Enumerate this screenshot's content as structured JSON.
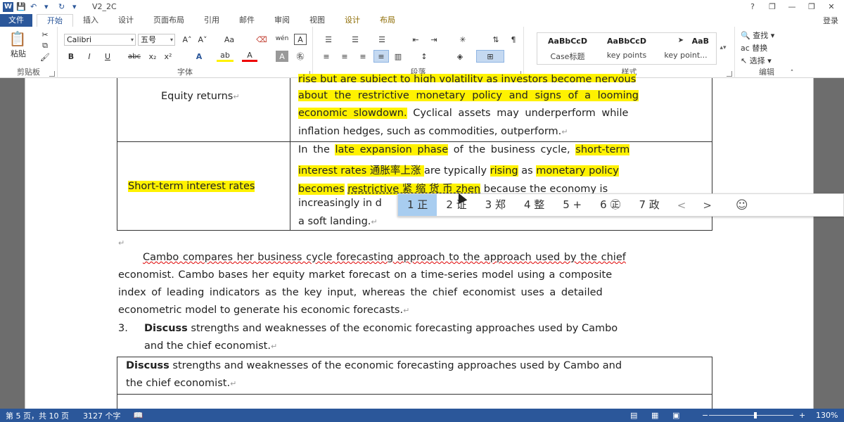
{
  "titlebar": {
    "title": "V2_2C",
    "help": "?",
    "min": "—",
    "restore": "❐",
    "close": "✕",
    "qa_save": "💾",
    "qa_undo": "↶",
    "qa_redo": "↻",
    "qa_dd": "▾",
    "app_icon": "W"
  },
  "tabs": [
    {
      "label": "文件"
    },
    {
      "label": "开始"
    },
    {
      "label": "插入"
    },
    {
      "label": "设计"
    },
    {
      "label": "页面布局"
    },
    {
      "label": "引用"
    },
    {
      "label": "邮件"
    },
    {
      "label": "审阅"
    },
    {
      "label": "视图"
    },
    {
      "label": "设计"
    },
    {
      "label": "布局"
    }
  ],
  "login": "登录",
  "ribbon": {
    "clipboard": {
      "label": "剪贴板",
      "paste": "粘贴"
    },
    "font": {
      "label": "字体",
      "font_name": "Calibri",
      "font_size": "五号",
      "grow": "A˄",
      "shrink": "A˅",
      "case": "Aa",
      "clear": "⌫",
      "phonetic": "wén",
      "border": "A",
      "bold": "B",
      "italic": "I",
      "underline": "U",
      "strike": "abc",
      "sub": "x₂",
      "sup": "x²",
      "effects": "A",
      "highlight": "ab",
      "fontcolor": "A",
      "shade": "A",
      "circle": "㊔"
    },
    "paragraph": {
      "label": "段落"
    },
    "styles": {
      "label": "样式",
      "items": [
        {
          "preview": "AaBbCcD",
          "name": "Case标题"
        },
        {
          "preview": "AaBbCcD",
          "name": "key points"
        },
        {
          "preview": "AaB",
          "name": "key point..."
        }
      ],
      "arrow": "➤"
    },
    "editing": {
      "label": "编辑",
      "find": "查找",
      "replace": "替换",
      "select": "选择"
    }
  },
  "doc": {
    "row1_label": "Equity returns",
    "row1_line0": "rise but are subject to high volatility as investors become nervous",
    "row1_line1": "about the restrictive monetary policy and signs of a looming",
    "row1_line2a": "economic slowdown.",
    "row1_line2b": " Cyclical assets may underperform while",
    "row1_line3": "inflation hedges, such as commodities, outperform.",
    "row2_label": "Short-term interest rates",
    "row2_l1a": "In the ",
    "row2_l1b": "late expansion phase",
    "row2_l1c": " of the business cycle, ",
    "row2_l1d": "short-term",
    "row2_l2a": "interest rates",
    "row2_l2b": " 通胀率上涨 ",
    "row2_l2c": " are typically ",
    "row2_l2d": "rising",
    "row2_l2e": " as ",
    "row2_l2f": "monetary policy",
    "row2_l3a": "becomes",
    "row2_l3b": "restrictive  紧 缩 货 币  zhen",
    "row2_l3c": " because the economy is",
    "row2_l4": "increasingly in d",
    "row2_l5": "a soft landing.",
    "para1_l1": "Cambo compares her business cycle forecasting approach to the approach used by the chief",
    "para1_l2": "economist. Cambo bases her equity market forecast on a time-series model using a composite",
    "para1_l3": "index of leading indicators as the key input, whereas the chief economist uses a detailed",
    "para1_l4": "econometric model to generate his economic forecasts.",
    "q3_num": "3.",
    "q3_l1a": "Discuss",
    "q3_l1b": " strengths and weaknesses of the economic forecasting approaches used by Cambo",
    "q3_l2": "and the chief economist.",
    "t2_l1a": "Discuss",
    "t2_l1b": " strengths and weaknesses of the economic forecasting approaches used by Cambo and",
    "t2_l2": "the chief economist."
  },
  "ime": {
    "candidates": [
      {
        "label": "1 正"
      },
      {
        "label": "2 证"
      },
      {
        "label": "3 郑"
      },
      {
        "label": "4 整"
      },
      {
        "label": "5 +"
      },
      {
        "label": "6 ㊣"
      },
      {
        "label": "7 政"
      }
    ],
    "prev": "<",
    "next": ">",
    "emoji": "☺"
  },
  "status": {
    "page": "第 5 页，共 10 页",
    "words": "3127 个字",
    "zoom": "130%",
    "zoom_level": 0.55
  }
}
